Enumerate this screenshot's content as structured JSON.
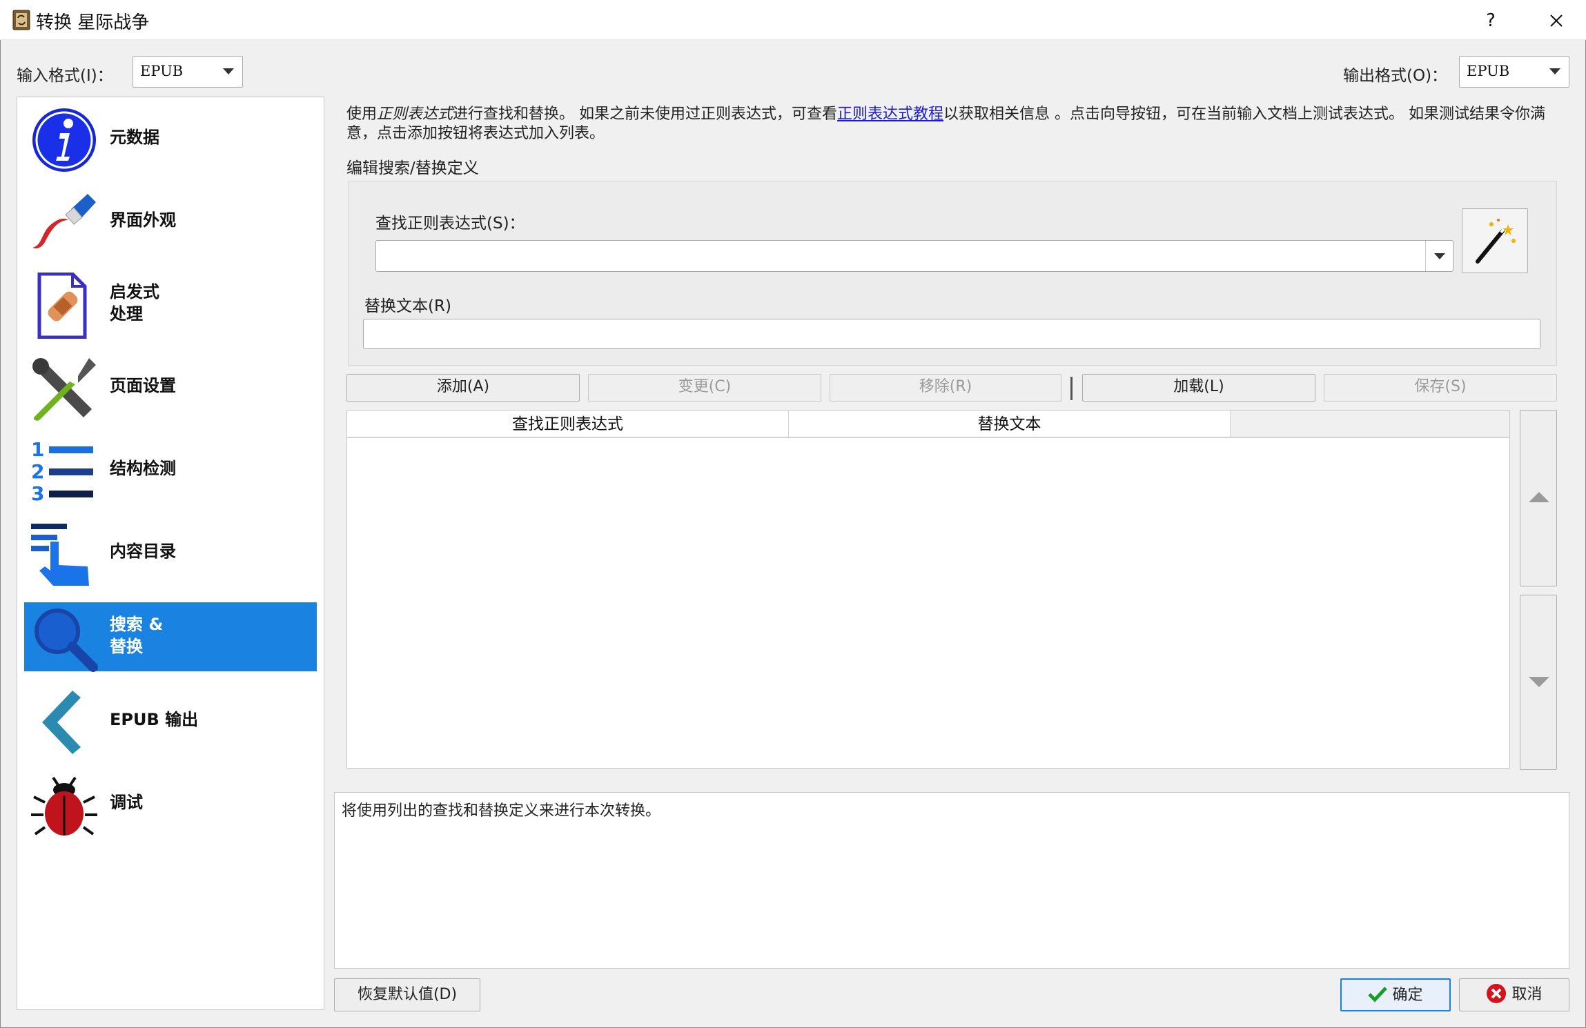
{
  "window": {
    "title": "转换 星际战争",
    "help": "?",
    "colors": {
      "accent": "#1a82e0",
      "link": "#1b1bd0"
    }
  },
  "formats": {
    "input_label": "输入格式(I)：",
    "input_value": "EPUB",
    "output_label": "输出格式(O)：",
    "output_value": "EPUB"
  },
  "sidebar": {
    "items": [
      {
        "label": "元数据",
        "icon": "info-icon"
      },
      {
        "label": "界面外观",
        "icon": "paintbrush-icon"
      },
      {
        "label": "启发式\n处理",
        "icon": "bandage-document-icon"
      },
      {
        "label": "页面设置",
        "icon": "tools-icon"
      },
      {
        "label": "结构检测",
        "icon": "numbered-list-icon"
      },
      {
        "label": "内容目录",
        "icon": "toc-hand-icon"
      },
      {
        "label": "搜索 &\n替换",
        "icon": "magnifier-icon",
        "selected": true
      },
      {
        "label": "EPUB 输出",
        "icon": "chevron-left-icon"
      },
      {
        "label": "调试",
        "icon": "bug-icon"
      }
    ]
  },
  "main": {
    "desc_part1": "使用",
    "desc_italic": "正则表达式",
    "desc_part2": "进行查找和替换。 如果之前未使用过正则表达式，可查看",
    "desc_link": "正则表达式教程",
    "desc_part3": "以获取相关信息 。点击向导按钮，可在当前输入文档上测试表达式。 如果测试结果令你满意，点击添加按钮将表达式加入列表。",
    "group_title": "编辑搜索/替换定义",
    "search_label": "查找正则表达式(S)：",
    "search_value": "",
    "replace_label": "替换文本(R)",
    "replace_value": "",
    "buttons": {
      "add": "添加(A)",
      "change": "变更(C)",
      "remove": "移除(R)",
      "load": "加载(L)",
      "save": "保存(S)"
    },
    "table_headers": [
      "查找正则表达式",
      "替换文本"
    ],
    "message": "将使用列出的查找和替换定义来进行本次转换。"
  },
  "footer": {
    "restore": "恢复默认值(D)",
    "ok": "确定",
    "cancel": "取消"
  }
}
